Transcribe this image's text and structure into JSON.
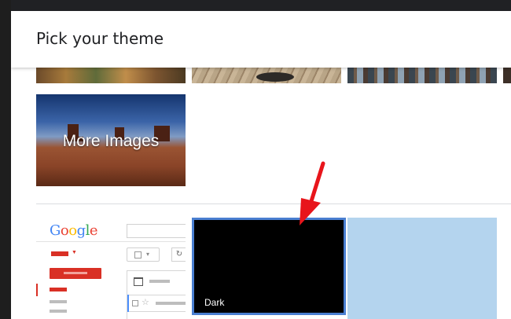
{
  "dialog": {
    "title": "Pick your theme"
  },
  "themes": {
    "more_images_label": "More Images",
    "dark_label": "Dark",
    "selected": "Dark"
  },
  "default_preview": {
    "logo_letters": [
      "G",
      "o",
      "o",
      "g",
      "l",
      "e"
    ],
    "logo_colors": [
      "#4285f4",
      "#ea4335",
      "#fbbc05",
      "#4285f4",
      "#34a853",
      "#ea4335"
    ]
  },
  "colors": {
    "selection_border": "#4a7fd1",
    "annotation_arrow": "#e8151b",
    "blue_tile": "#b4d4ee"
  }
}
